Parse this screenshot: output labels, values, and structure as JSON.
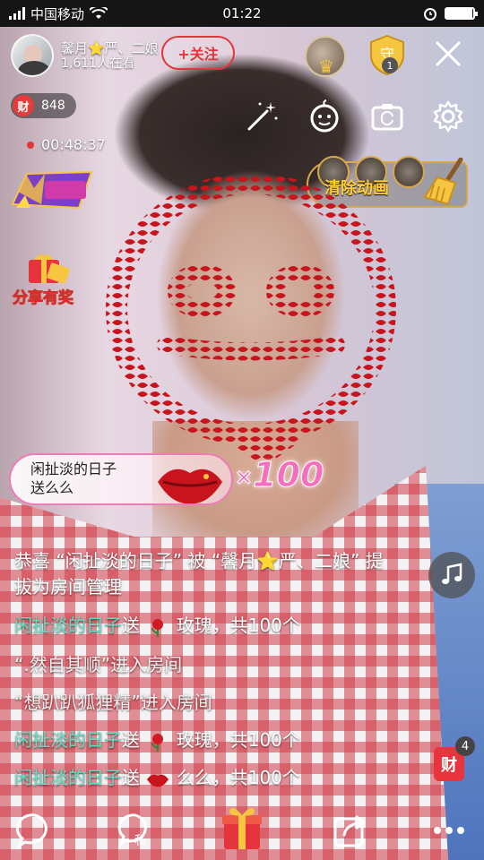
{
  "status_bar": {
    "carrier": "中国移动",
    "time": "01:22",
    "battery_level": 0.95
  },
  "host": {
    "name": "馨月⭐严、二娘",
    "viewers": "1,611人在看",
    "follow_label": "+关注"
  },
  "top_actions": {
    "shield_count": "1"
  },
  "wealth": {
    "icon_label": "财",
    "value": "848"
  },
  "timer": "00:48:37",
  "side_badges": {
    "dance_logo_icon": "dance-show-icon",
    "share_reward_label": "分享有奖"
  },
  "clear_animation_label": "清除动画",
  "gift_banner": {
    "sender": "闲扯淡的日子\n送么么",
    "count": "100",
    "count_prefix": "×"
  },
  "chat": [
    {
      "type": "system",
      "text": "恭喜 “闲扯淡的日子” 被 “馨月⭐严、二娘” 提拔为房间管理"
    },
    {
      "type": "gift",
      "name": "闲扯淡的日子",
      "verb": "送",
      "gift_icon": "rose-icon",
      "tail": " 玫瑰，共100个"
    },
    {
      "type": "enter",
      "text": "“.然自其顺”进入房间"
    },
    {
      "type": "enter",
      "text": "“想趴趴狐狸精”进入房间"
    },
    {
      "type": "gift",
      "name": "闲扯淡的日子",
      "verb": "送",
      "gift_icon": "rose-icon",
      "tail": " 玫瑰，共100个"
    },
    {
      "type": "gift",
      "name": "闲扯淡的日子",
      "verb": "送",
      "gift_icon": "lips-icon",
      "tail": " 么么，共100个"
    }
  ],
  "right_widgets": {
    "cai_bag_label": "财",
    "cai_bag_count": "4"
  },
  "bottom_bar": {
    "private_label": "私"
  },
  "colors": {
    "accent_red": "#e5343c",
    "chat_name": "#5fe0c5",
    "gift_count_pink": "#f46fbd",
    "gold": "#d7a84c"
  }
}
